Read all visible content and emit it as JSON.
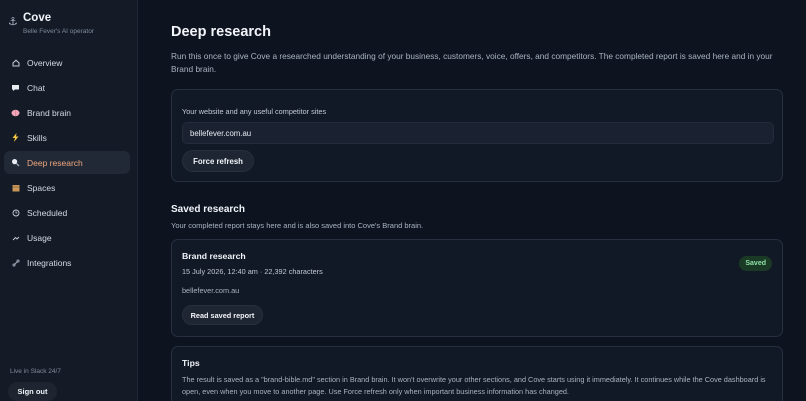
{
  "sidebar": {
    "brand_name": "Cove",
    "brand_sub": "Belle Fever's AI operator",
    "items": [
      {
        "label": "Overview",
        "icon": "home-icon"
      },
      {
        "label": "Chat",
        "icon": "chat-bubble-icon"
      },
      {
        "label": "Brand brain",
        "icon": "brain-icon"
      },
      {
        "label": "Skills",
        "icon": "lightning-icon"
      },
      {
        "label": "Deep research",
        "icon": "magnifier-icon",
        "active": true
      },
      {
        "label": "Spaces",
        "icon": "package-icon"
      },
      {
        "label": "Scheduled",
        "icon": "clock-icon"
      },
      {
        "label": "Usage",
        "icon": "chart-icon"
      },
      {
        "label": "Integrations",
        "icon": "link-icon"
      }
    ],
    "slack_status": "Live in Slack 24/7",
    "signout_label": "Sign out"
  },
  "main": {
    "title": "Deep research",
    "intro": "Run this once to give Cove a researched understanding of your business, customers, voice, offers, and competitors. The completed report is saved here and in your Brand brain.",
    "input_label": "Your website and any useful competitor sites",
    "input_value": "bellefever.com.au",
    "force_refresh_label": "Force refresh",
    "saved_title": "Saved research",
    "saved_sub": "Your completed report stays here and is also saved into Cove's Brand brain.",
    "report": {
      "title": "Brand research",
      "meta": "15 July 2026, 12:40 am · 22,392 characters",
      "site": "bellefever.com.au",
      "badge": "Saved",
      "read_label": "Read saved report"
    },
    "tips": {
      "title": "Tips",
      "body": "The result is saved as a \"brand-bible.md\" section in Brand brain. It won't overwrite your other sections, and Cove starts using it immediately. It continues while the Cove dashboard is open, even when you move to another page. Use Force refresh only when important business information has changed."
    }
  },
  "colors": {
    "accent": "#f0a77f",
    "badge_bg": "#1b3a26",
    "badge_text": "#8fe0a6",
    "background": "#0d1420"
  }
}
